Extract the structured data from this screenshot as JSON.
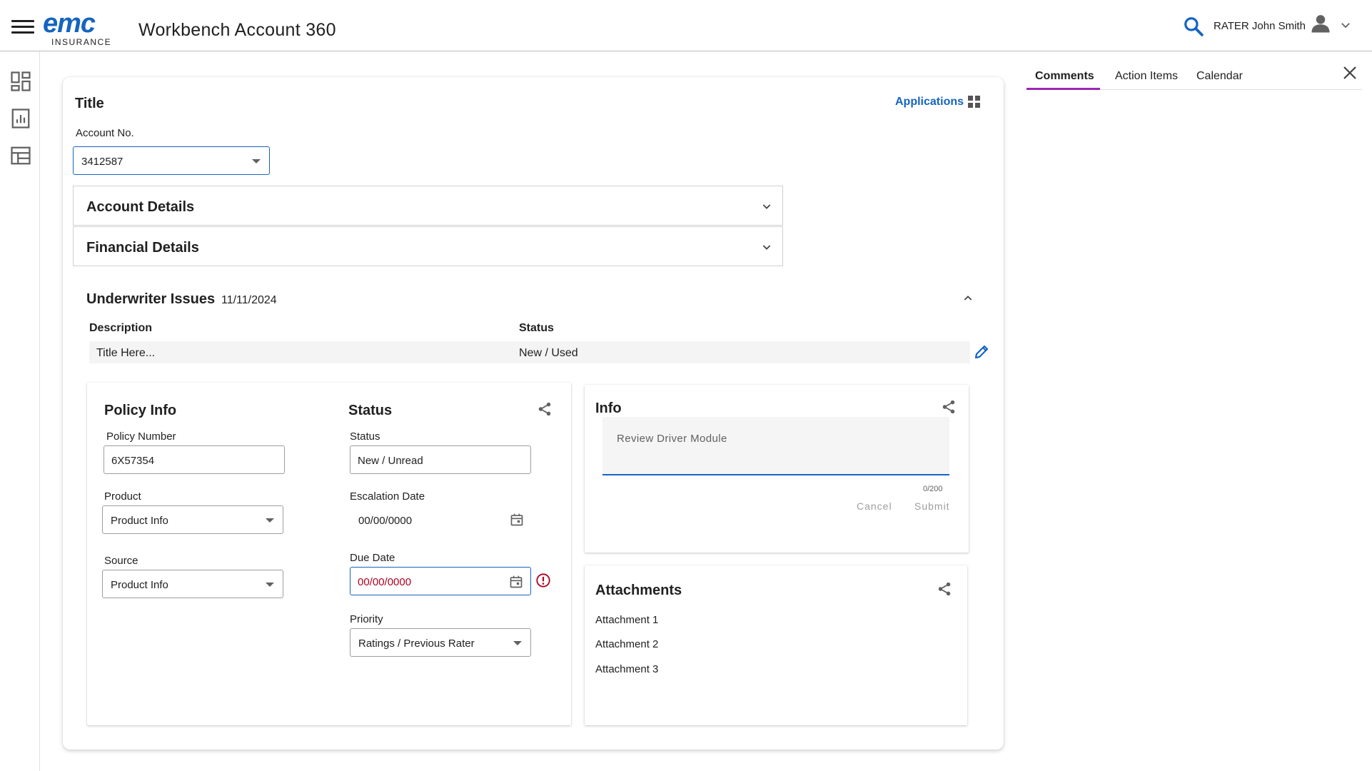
{
  "header": {
    "logo_text": "emc",
    "logo_sub": "INSURANCE",
    "title": "Workbench Account 360",
    "user_name": "RATER John Smith"
  },
  "card": {
    "title": "Title",
    "applications_label": "Applications",
    "account_no_label": "Account No.",
    "account_no_value": "3412587",
    "accordions": [
      "Account Details",
      "Financial Details"
    ]
  },
  "underwriter": {
    "title": "Underwriter Issues",
    "date": "11/11/2024",
    "columns": [
      "Description",
      "Status"
    ],
    "row": {
      "description": "Title Here...",
      "status": "New / Used"
    }
  },
  "policy_info": {
    "title": "Policy Info",
    "policy_number_label": "Policy Number",
    "policy_number_value": "6X57354",
    "product_label": "Product",
    "product_value": "Product Info",
    "source_label": "Source",
    "source_value": "Product Info"
  },
  "status_panel": {
    "title": "Status",
    "status_label": "Status",
    "status_value": "New / Unread",
    "escalation_label": "Escalation Date",
    "escalation_value": "00/00/0000",
    "due_label": "Due Date",
    "due_value": "00/00/0000",
    "priority_label": "Priority",
    "priority_value": "Ratings / Previous Rater"
  },
  "info_panel": {
    "title": "Info",
    "placeholder": "Review Driver Module",
    "counter": "0/200",
    "cancel_label": "Cancel",
    "submit_label": "Submit"
  },
  "attachments": {
    "title": "Attachments",
    "items": [
      "Attachment 1",
      "Attachment 2",
      "Attachment 3"
    ]
  },
  "right_pane": {
    "tabs": [
      "Comments",
      "Action Items",
      "Calendar"
    ],
    "active_tab": "Comments"
  },
  "colors": {
    "brand": "#1565c0",
    "tab_indicator": "#9c27b0",
    "error": "#b00020"
  }
}
